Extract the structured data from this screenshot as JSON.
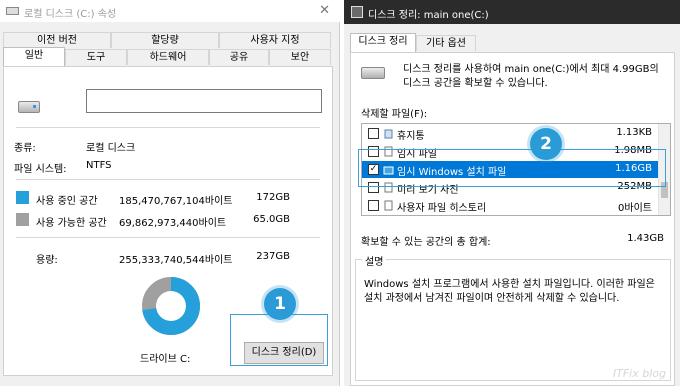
{
  "left": {
    "title": "로컬 디스크 (C:) 속성",
    "tabs_row1": [
      "이전 버전",
      "할당량",
      "사용자 지정"
    ],
    "tabs_row2": [
      "일반",
      "도구",
      "하드웨어",
      "공유",
      "보안"
    ],
    "type_label": "종류:",
    "type_value": "로컬 디스크",
    "fs_label": "파일 시스템:",
    "fs_value": "NTFS",
    "used_label": "사용 중인 공간",
    "used_bytes": "185,470,767,104바이트",
    "used_gb": "172GB",
    "free_label": "사용 가능한 공간",
    "free_bytes": "69,862,973,440바이트",
    "free_gb": "65.0GB",
    "capacity_label": "용량:",
    "capacity_bytes": "255,333,740,544바이트",
    "capacity_gb": "237GB",
    "drive_label": "드라이브 C:",
    "cleanup_button": "디스크 정리(D)",
    "used_fraction": 0.726,
    "colors": {
      "used": "#26a0da",
      "free": "#a0a0a0"
    }
  },
  "right": {
    "title": "디스크 정리: main one(C:)",
    "tabs": [
      "디스크 정리",
      "기타 옵션"
    ],
    "intro": "디스크 정리를 사용하여 main one(C:)에서 최대 4.99GB의 디스크 공간을 확보할 수 있습니다.",
    "files_label": "삭제할 파일(F):",
    "files": [
      {
        "name": "휴지통",
        "size": "1.13KB",
        "checked": false,
        "selected": false
      },
      {
        "name": "임시 파일",
        "size": "1.98MB",
        "checked": false,
        "selected": false
      },
      {
        "name": "임시 Windows 설치 파일",
        "size": "1.16GB",
        "checked": true,
        "selected": true
      },
      {
        "name": "미리 보기 사진",
        "size": "252MB",
        "checked": false,
        "selected": false
      },
      {
        "name": "사용자 파일 히스토리",
        "size": "0바이트",
        "checked": false,
        "selected": false
      }
    ],
    "total_label": "확보할 수 있는 공간의 총 합계:",
    "total_value": "1.43GB",
    "desc_title": "설명",
    "desc_text": "Windows 설치 프로그램에서 사용한 설치 파일입니다. 이러한 파일은 설치 과정에서 남겨진 파일이며 안전하게 삭제할 수 있습니다."
  },
  "annotations": {
    "badge1": "1",
    "badge2": "2"
  },
  "watermark": "ITFix blog"
}
